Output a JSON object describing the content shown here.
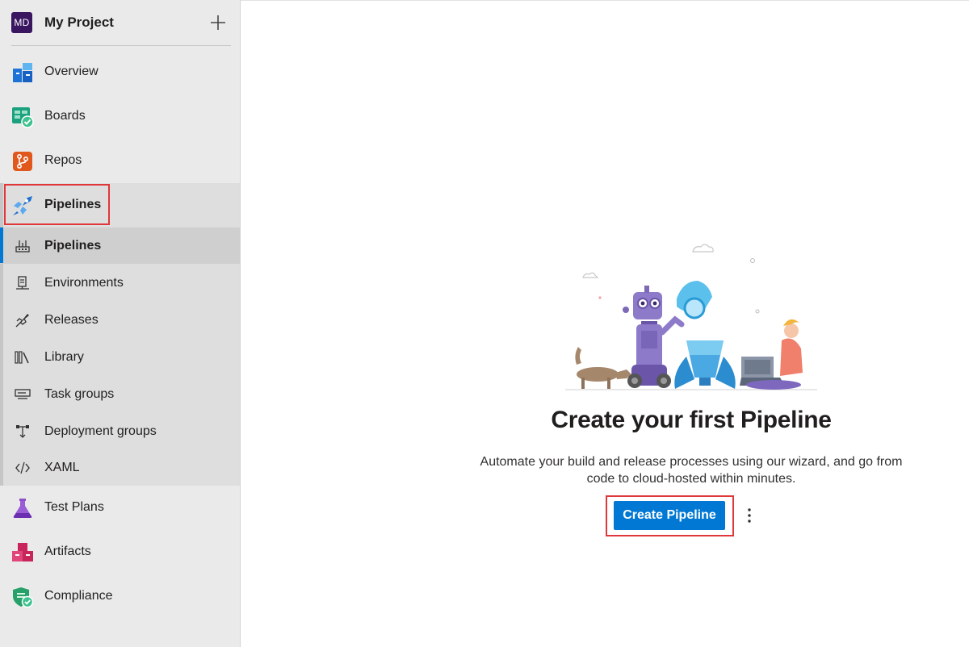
{
  "project": {
    "initials": "MD",
    "name": "My Project"
  },
  "nav": {
    "overview": "Overview",
    "boards": "Boards",
    "repos": "Repos",
    "pipelines": "Pipelines",
    "test_plans": "Test Plans",
    "artifacts": "Artifacts",
    "compliance": "Compliance"
  },
  "pipelines_submenu": {
    "pipelines": "Pipelines",
    "environments": "Environments",
    "releases": "Releases",
    "library": "Library",
    "task_groups": "Task groups",
    "deployment_groups": "Deployment groups",
    "xaml": "XAML",
    "selected": "Pipelines"
  },
  "empty_state": {
    "headline": "Create your first Pipeline",
    "description": "Automate your build and release processes using our wizard, and go from code to cloud-hosted within minutes.",
    "create_button": "Create Pipeline"
  },
  "colors": {
    "accent": "#0078d4",
    "highlight": "#e0373b",
    "avatar": "#3a1560"
  },
  "icons": [
    "add-icon",
    "overview-icon",
    "boards-icon",
    "repos-icon",
    "pipelines-icon",
    "pipeline-sub-icon",
    "environments-icon",
    "releases-icon",
    "library-icon",
    "task-groups-icon",
    "deployment-groups-icon",
    "xaml-icon",
    "test-plans-icon",
    "artifacts-icon",
    "compliance-icon",
    "more-options-icon"
  ]
}
